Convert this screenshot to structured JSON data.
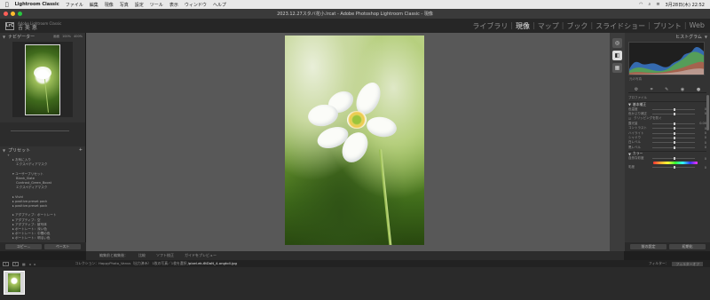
{
  "menubar": {
    "apple": "",
    "app": "Lightroom Classic",
    "items": [
      "ファイル",
      "編集",
      "現像",
      "写真",
      "設定",
      "ツール",
      "表示",
      "ウィンドウ",
      "ヘルプ"
    ],
    "datetime": "3月28日(木) 22:52"
  },
  "window": {
    "title": "2023.12.27スタバ花小.lrcat - Adobe Photoshop Lightroom Classic - 現像"
  },
  "identity": {
    "logo": "LrC",
    "line1": "Adobe Lightroom Classic",
    "line2": "吉 美 恵"
  },
  "modules": {
    "items": [
      "ライブラリ",
      "現像",
      "マップ",
      "ブック",
      "スライドショー",
      "プリント",
      "Web"
    ],
    "active_index": 1
  },
  "left_panel": {
    "navigator_label": "ナビゲーター",
    "zoom_options": [
      "画面",
      "100%",
      "400%"
    ],
    "presets_label": "プリセット",
    "presets": [
      {
        "text": "+",
        "level": 0
      },
      {
        "text": "▸ お気に入り",
        "level": 1
      },
      {
        "text": "エクスペディアマスク",
        "level": 2
      },
      {
        "text": "",
        "level": 0
      },
      {
        "text": "▾ ユーザープリセット",
        "level": 1
      },
      {
        "text": "Blank_Slate",
        "level": 2
      },
      {
        "text": "Contrast_Green_Boost",
        "level": 2
      },
      {
        "text": "エクスペディアマスク",
        "level": 2
      },
      {
        "text": "",
        "level": 0
      },
      {
        "text": "▸ Vivid",
        "level": 1
      },
      {
        "text": "▸ positive.preset pack",
        "level": 1
      },
      {
        "text": "▸ positive.preset pack",
        "level": 1
      },
      {
        "text": "",
        "level": 0
      },
      {
        "text": "▸ アダプティブ：ポートレート",
        "level": 1
      },
      {
        "text": "▸ アダプティブ：空",
        "level": 1
      },
      {
        "text": "▸ アダプティブ：被写体",
        "level": 1
      },
      {
        "text": "▸ ポートレート：深い色",
        "level": 1
      },
      {
        "text": "▸ ポートレート：中間の色",
        "level": 1
      },
      {
        "text": "▸ ポートレート：明るい色",
        "level": 1
      }
    ],
    "copy_button": "コピー...",
    "paste_button": "ペースト"
  },
  "toolbar": {
    "items": [
      "編集前と編集後：",
      "比較",
      "ソフト校正",
      "ガイドをプレビュー"
    ]
  },
  "right_panel": {
    "histogram_label": "ヒストグラム",
    "original_photo": "元の写真",
    "profile_label": "プロファイル",
    "sections": [
      {
        "name": "基本補正",
        "rows": [
          {
            "label": "色温度",
            "value": "0",
            "pos": 0.5
          },
          {
            "label": "色かぶり補正",
            "value": "0",
            "pos": 0.5
          },
          {
            "label": "露光量",
            "value": "0.00",
            "pos": 0.5
          },
          {
            "label": "コントラスト",
            "value": "0",
            "pos": 0.5
          },
          {
            "label": "ハイライト",
            "value": "0",
            "pos": 0.5
          },
          {
            "label": "シャドウ",
            "value": "0",
            "pos": 0.5
          },
          {
            "label": "白レベル",
            "value": "0",
            "pos": 0.5
          },
          {
            "label": "黒レベル",
            "value": "0",
            "pos": 0.5
          }
        ]
      },
      {
        "name": "カラー",
        "rows": [
          {
            "label": "自然な彩度",
            "value": "0",
            "pos": 0.5
          },
          {
            "label": "彩度",
            "value": "0",
            "pos": 0.5
          }
        ]
      }
    ],
    "checkbox_label": "クリッピングを防ぐ",
    "prev_button": "前の設定",
    "reset_button": "初期化"
  },
  "filmbar": {
    "collection": "コレクション：HappyPhoto_Vanus（出力済み）",
    "count_info": "1枚の写真／1枚を選択",
    "filename": "/pixel.ek-6tDaN_4-ongtoll.jpg",
    "filter_label": "フィルター：",
    "filter_value": "フィルターオフ"
  },
  "theme": {
    "accent": "#e6e6e6",
    "panel_bg": "#333333",
    "canvas_bg": "#585858"
  }
}
